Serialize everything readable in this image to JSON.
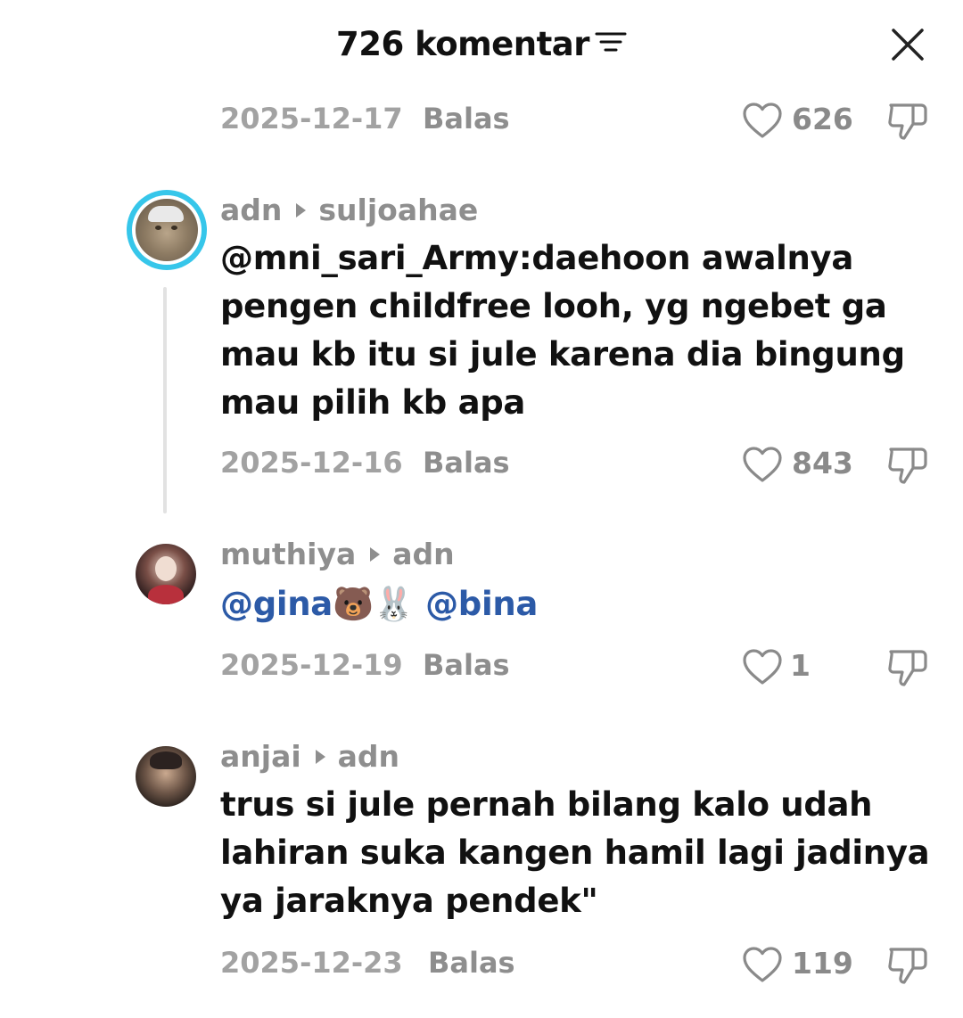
{
  "header": {
    "count": "726 komentar"
  },
  "top_row": {
    "date": "2025-12-17",
    "reply_label": "Balas",
    "likes": "626"
  },
  "comments": [
    {
      "author": "adn",
      "reply_to": "suljoahae",
      "text": "@mni_sari_Army:daehoon awalnya pengen childfree looh, yg ngebet ga mau kb itu si jule karena dia bingung mau pilih kb apa",
      "date": "2025-12-16",
      "reply_label": "Balas",
      "likes": "843"
    },
    {
      "author": "muthiya",
      "reply_to": "adn",
      "mention1": "@gina🐻🐰",
      "mention2": "@bina",
      "date": "2025-12-19",
      "reply_label": "Balas",
      "likes": "1"
    },
    {
      "author": "anjai",
      "reply_to": "adn",
      "text": "trus si jule pernah bilang kalo udah lahiran suka kangen hamil lagi jadinya ya jaraknya pendek\"",
      "date": "2025-12-23",
      "reply_label": "Balas",
      "likes": "119"
    }
  ],
  "icons": {
    "filter": "filter-lines-icon",
    "close": "close-x-icon",
    "like": "heart-outline-icon",
    "dislike": "thumbs-down-outline-icon"
  },
  "colors": {
    "mention": "#2c5aa7",
    "avatar_ring": "#36c6ea",
    "muted_text": "#8e8e8e"
  }
}
